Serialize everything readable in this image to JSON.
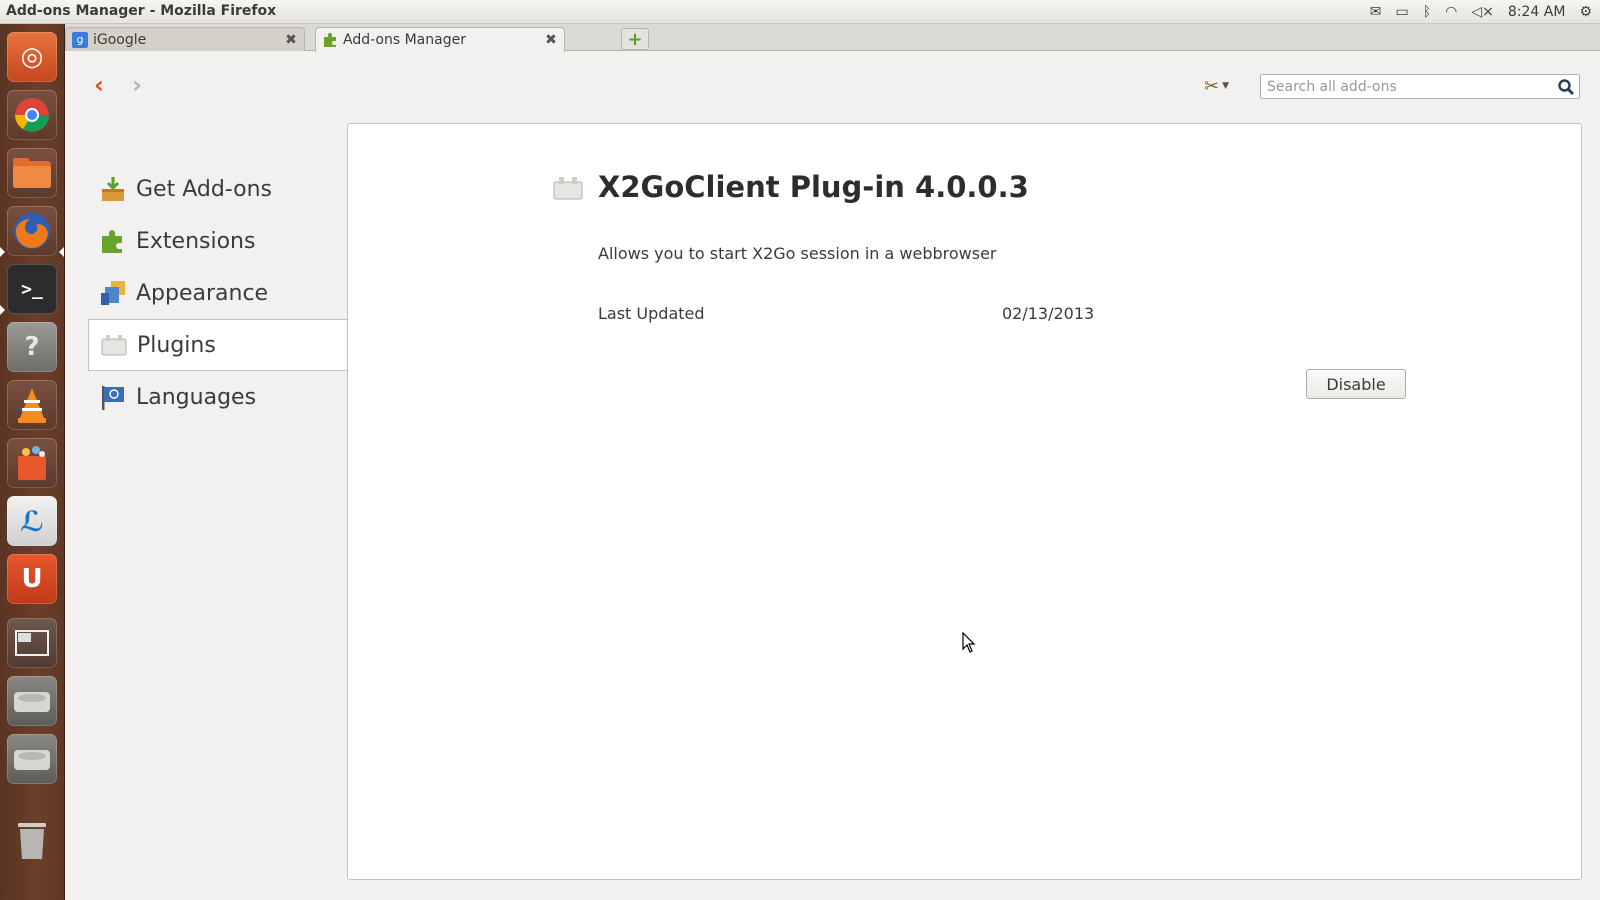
{
  "window": {
    "title": "Add-ons Manager - Mozilla Firefox"
  },
  "panel": {
    "indicators": [
      "mail-icon",
      "battery-icon",
      "bluetooth-icon",
      "wifi-icon",
      "volume-muted-icon"
    ],
    "clock": "8:24 AM",
    "session_icon": "gear-icon"
  },
  "launcher": {
    "items": [
      "ubuntu-dash",
      "chromium",
      "files",
      "firefox",
      "terminal",
      "help",
      "vlc",
      "software-center",
      "libreoffice",
      "ubuntu-one",
      "workspace-switcher",
      "disk-1",
      "disk-2",
      "trash"
    ]
  },
  "tabs": [
    {
      "label": "iGoogle",
      "favicon": "g",
      "active": false
    },
    {
      "label": "Add-ons Manager",
      "favicon": "puzzle",
      "active": true
    }
  ],
  "toolbar": {
    "search_placeholder": "Search all add-ons"
  },
  "categories": [
    {
      "label": "Get Add-ons",
      "icon": "get-addons-icon",
      "selected": false
    },
    {
      "label": "Extensions",
      "icon": "puzzle-icon",
      "selected": false
    },
    {
      "label": "Appearance",
      "icon": "appearance-icon",
      "selected": false
    },
    {
      "label": "Plugins",
      "icon": "plugin-icon",
      "selected": true
    },
    {
      "label": "Languages",
      "icon": "flag-icon",
      "selected": false
    }
  ],
  "detail": {
    "name": "X2GoClient Plug-in 4.0.0.3",
    "description": "Allows you to start X2Go session in a webbrowser",
    "last_updated_label": "Last Updated",
    "last_updated_value": "02/13/2013",
    "disable_label": "Disable"
  },
  "colors": {
    "launcher": "#5f3825",
    "accent": "#d9541e",
    "panel_bg": "#ffffff"
  }
}
